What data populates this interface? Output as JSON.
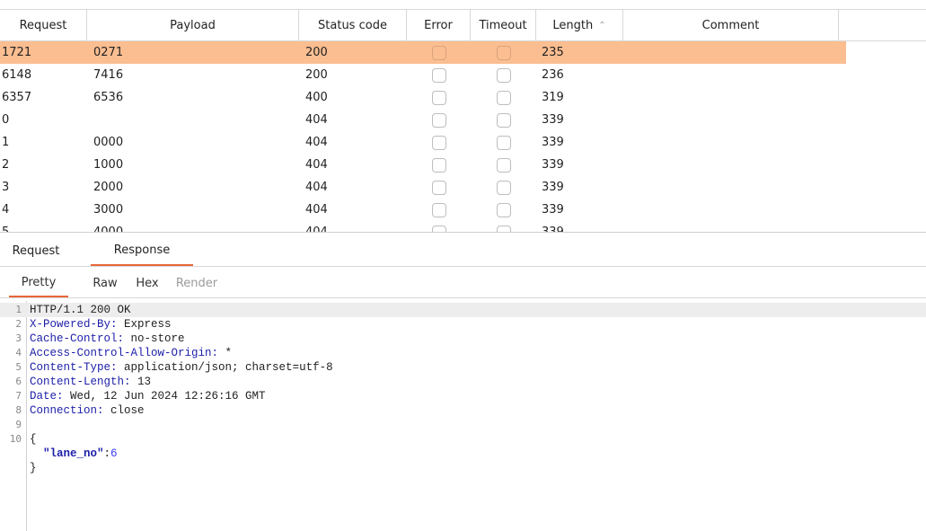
{
  "table": {
    "columns": [
      "Request",
      "Payload",
      "Status code",
      "Error",
      "Timeout",
      "Length",
      "Comment"
    ],
    "sort_indicator": "^",
    "rows": [
      {
        "request": "1721",
        "payload": "0271",
        "status": "200",
        "length": "235"
      },
      {
        "request": "6148",
        "payload": "7416",
        "status": "200",
        "length": "236"
      },
      {
        "request": "6357",
        "payload": "6536",
        "status": "400",
        "length": "319"
      },
      {
        "request": "0",
        "payload": "",
        "status": "404",
        "length": "339"
      },
      {
        "request": "1",
        "payload": "0000",
        "status": "404",
        "length": "339"
      },
      {
        "request": "2",
        "payload": "1000",
        "status": "404",
        "length": "339"
      },
      {
        "request": "3",
        "payload": "2000",
        "status": "404",
        "length": "339"
      },
      {
        "request": "4",
        "payload": "3000",
        "status": "404",
        "length": "339"
      },
      {
        "request": "5",
        "payload": "4000",
        "status": "404",
        "length": "339"
      }
    ],
    "selected_row_color": "#fbbe91"
  },
  "tabs": {
    "request": "Request",
    "response": "Response"
  },
  "subtabs": {
    "pretty": "Pretty",
    "raw": "Raw",
    "hex": "Hex",
    "render": "Render"
  },
  "editor": {
    "lines": [
      {
        "n": "1",
        "key": "",
        "text": "HTTP/1.1 200 OK"
      },
      {
        "n": "2",
        "key": "X-Powered-By:",
        "text": " Express"
      },
      {
        "n": "3",
        "key": "Cache-Control:",
        "text": " no-store"
      },
      {
        "n": "4",
        "key": "Access-Control-Allow-Origin:",
        "text": " *"
      },
      {
        "n": "5",
        "key": "Content-Type:",
        "text": " application/json; charset=utf-8"
      },
      {
        "n": "6",
        "key": "Content-Length:",
        "text": " 13"
      },
      {
        "n": "7",
        "key": "Date:",
        "text": " Wed, 12 Jun 2024 12:26:16 GMT"
      },
      {
        "n": "8",
        "key": "Connection:",
        "text": " close"
      },
      {
        "n": "9",
        "key": "",
        "text": ""
      },
      {
        "n": "10",
        "key": "",
        "text": "{"
      },
      {
        "n": "",
        "key": "",
        "text": "  ",
        "json_key": "\"lane_no\"",
        "json_sep": ":",
        "json_val": "6"
      },
      {
        "n": "",
        "key": "",
        "text": "}"
      }
    ],
    "accent_color": "#e8663a"
  }
}
